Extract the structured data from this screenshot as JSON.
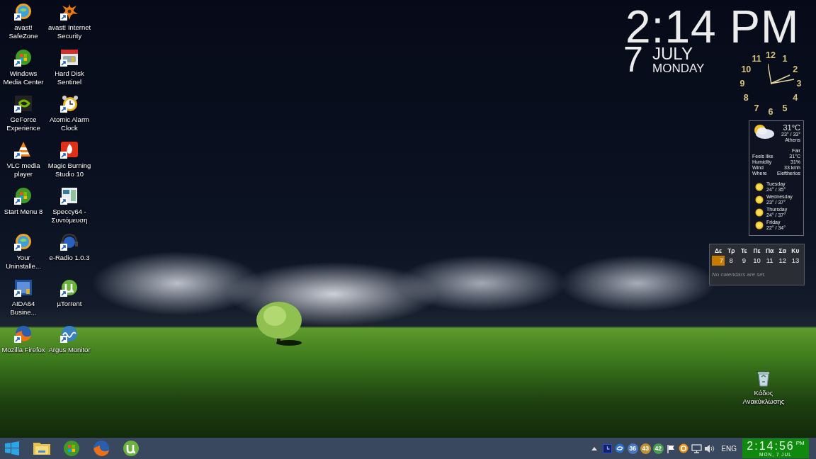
{
  "desktop_icons": [
    {
      "label": "avast! SafeZone",
      "kind": "globe"
    },
    {
      "label": "avast! Internet Security",
      "kind": "splat"
    },
    {
      "label": "Windows Media Center",
      "kind": "orb"
    },
    {
      "label": "Hard Disk Sentinel",
      "kind": "disk"
    },
    {
      "label": "GeForce Experience",
      "kind": "eye"
    },
    {
      "label": "Atomic Alarm Clock",
      "kind": "alarm"
    },
    {
      "label": "VLC media player",
      "kind": "cone"
    },
    {
      "label": "Magic Burning Studio 10",
      "kind": "flame"
    },
    {
      "label": "Start Menu 8",
      "kind": "orb"
    },
    {
      "label": "Speccy64 - Συντόμευση",
      "kind": "window"
    },
    {
      "label": "Your Uninstalle...",
      "kind": "globe"
    },
    {
      "label": "e-Radio 1.0.3",
      "kind": "headphones"
    },
    {
      "label": "AIDA64 Busine...",
      "kind": "tile"
    },
    {
      "label": "µTorrent",
      "kind": "torrent"
    },
    {
      "label": "Mozilla Firefox",
      "kind": "fox"
    },
    {
      "label": "Argus Monitor",
      "kind": "wave"
    }
  ],
  "recycle_bin": {
    "label": "Κάδος Ανακύκλωσης"
  },
  "clock_gadget": {
    "time": "2:14 PM",
    "day": "7",
    "month": "JULY",
    "weekday": "MONDAY"
  },
  "analog_clock": {
    "numerals": [
      "11",
      "12",
      "1",
      "10",
      "2",
      "9",
      "3",
      "8",
      "4",
      "7",
      "5",
      "6"
    ]
  },
  "weather": {
    "temperature": "31°C",
    "range": "23° / 33°",
    "city": "Athens",
    "condition": "Fair",
    "details": [
      {
        "label": "Feels like",
        "value": "31°C"
      },
      {
        "label": "Humidity",
        "value": "31%"
      },
      {
        "label": "Wind",
        "value": "33 kmh"
      },
      {
        "label": "Where",
        "value": "Eleftherios"
      }
    ],
    "forecast": [
      {
        "day": "Tuesday",
        "range": "24° / 35°"
      },
      {
        "day": "Wednesday",
        "range": "23° / 37°"
      },
      {
        "day": "Thursday",
        "range": "24° / 37°"
      },
      {
        "day": "Friday",
        "range": "22° / 34°"
      }
    ]
  },
  "calendar": {
    "weekdays": [
      "Δε",
      "Τρ",
      "Τε",
      "Πε",
      "Πα",
      "Σα",
      "Κυ"
    ],
    "days": [
      {
        "label": "7",
        "selected": true
      },
      {
        "label": "8",
        "selected": false
      },
      {
        "label": "9",
        "selected": false
      },
      {
        "label": "10",
        "selected": false
      },
      {
        "label": "11",
        "selected": false
      },
      {
        "label": "12",
        "selected": false
      },
      {
        "label": "13",
        "selected": false
      }
    ],
    "note": "No calendars are set."
  },
  "taskbar": {
    "apps": [
      {
        "kind": "start"
      },
      {
        "kind": "folder"
      },
      {
        "kind": "orb"
      },
      {
        "kind": "fox"
      },
      {
        "kind": "torrent"
      }
    ],
    "tray": [
      {
        "kind": "caret"
      },
      {
        "kind": "clock"
      },
      {
        "kind": "sync"
      },
      {
        "kind": "temp",
        "text": "36",
        "color": "#4a78c0"
      },
      {
        "kind": "temp",
        "text": "43",
        "color": "#c09030"
      },
      {
        "kind": "temp",
        "text": "42",
        "color": "#4a9a50"
      },
      {
        "kind": "flag"
      },
      {
        "kind": "ring"
      },
      {
        "kind": "network"
      },
      {
        "kind": "speaker"
      }
    ],
    "language": "ENG",
    "time": "2:14:56",
    "ampm": "PM",
    "date": "MON, 7 JUL"
  }
}
